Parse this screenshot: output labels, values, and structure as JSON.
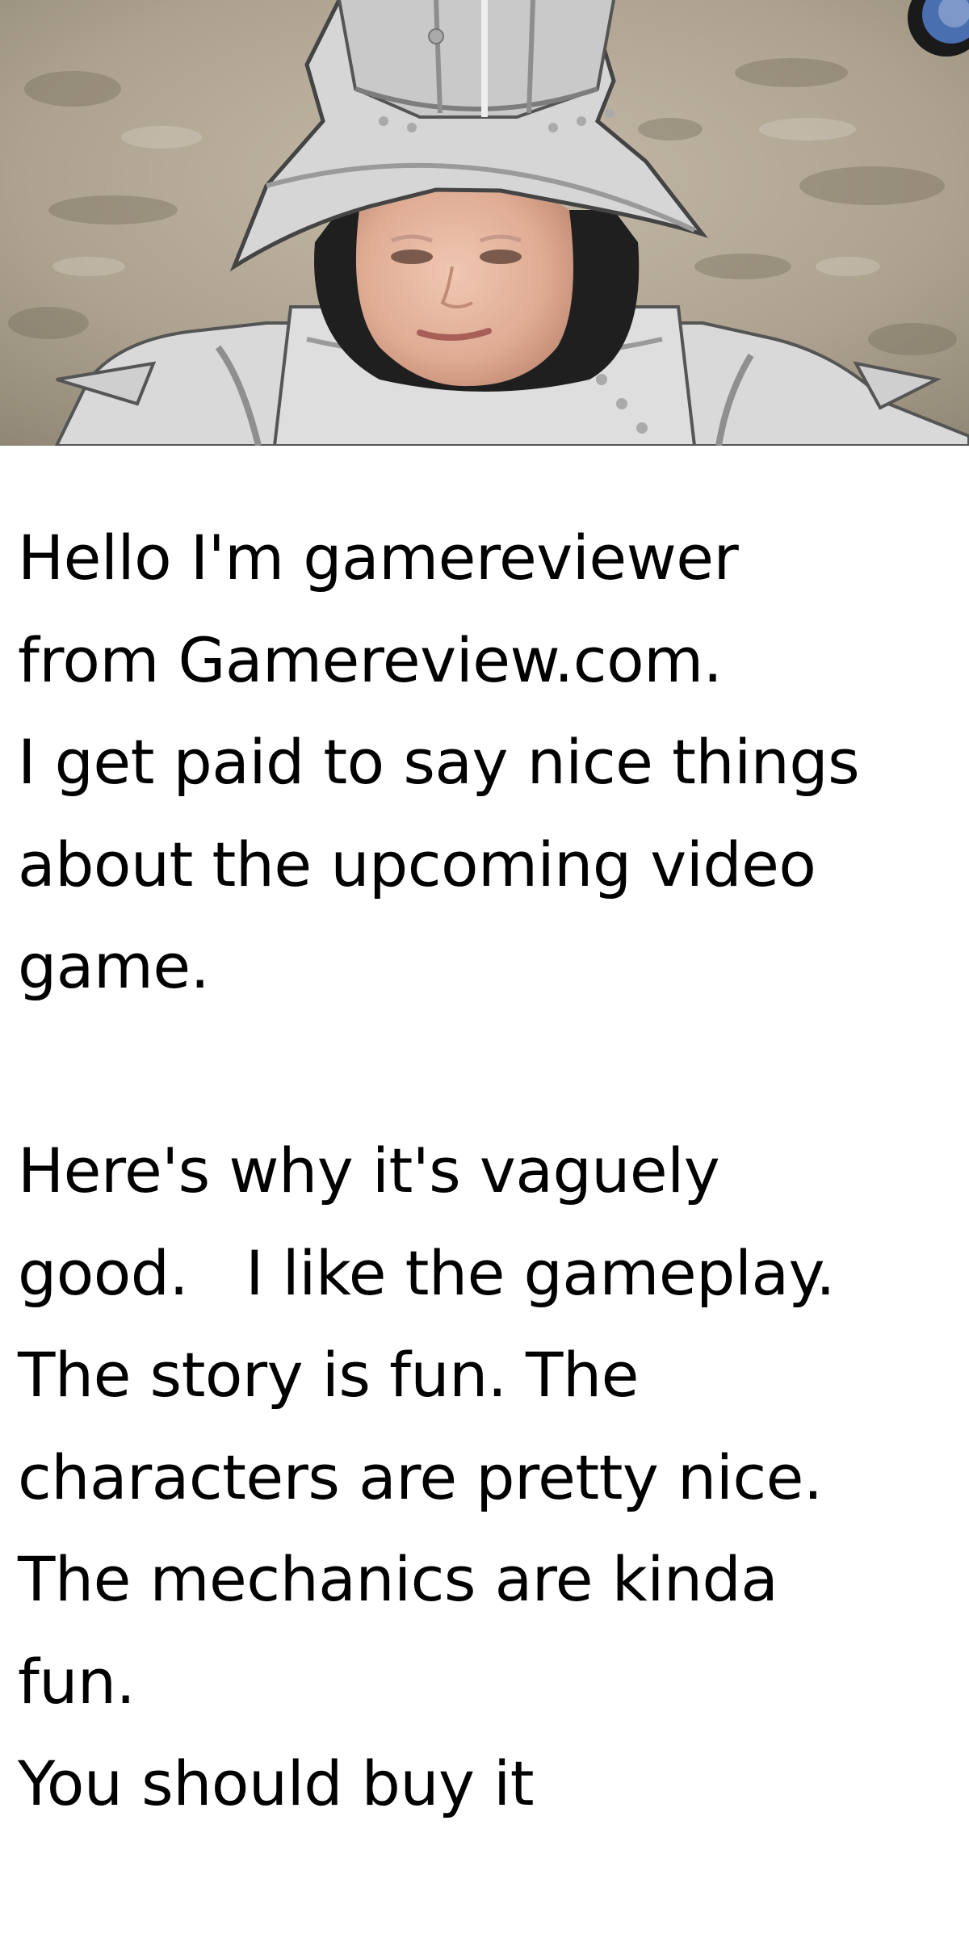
{
  "scene": {
    "colors": {
      "wall": "#b7ad9c",
      "armor": "#d6d6d6",
      "armor_shadow": "#a9a9a9",
      "dark": "#1f1f1f",
      "skin": "#e3b6a0"
    }
  },
  "caption": {
    "lines": [
      "Hello I'm gamereviewer",
      "from Gamereview.com.",
      "I get paid to say nice things",
      "about the upcoming video",
      "game.",
      "",
      "Here's why it's vaguely",
      "good.   I like the gameplay.",
      "The story is fun. The",
      "characters are pretty nice.",
      "The mechanics are kinda",
      "fun.",
      "You should buy it"
    ]
  }
}
